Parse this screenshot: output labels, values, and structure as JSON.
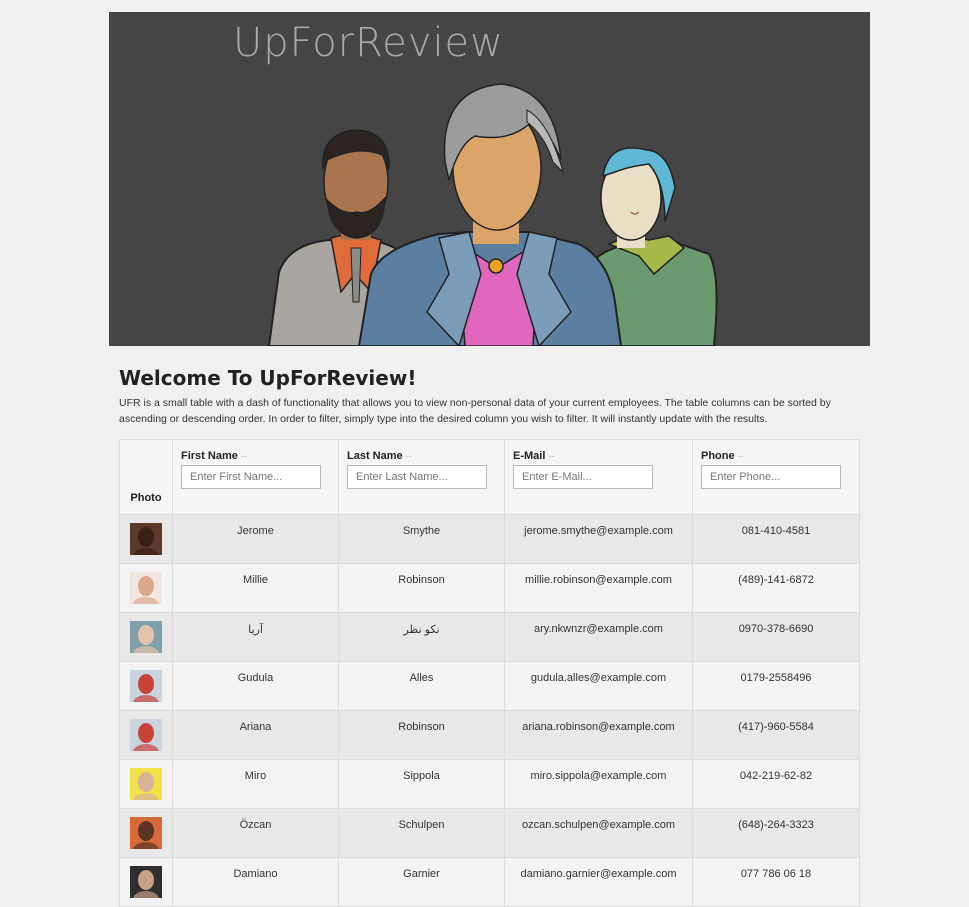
{
  "hero": {
    "title": "UpForReview"
  },
  "intro": {
    "heading": "Welcome To UpForReview!",
    "description": "UFR is a small table with a dash of functionality that allows you to view non-personal data of your current employees. The table columns can be sorted by ascending or descending order. In order to filter, simply type into the desired column you wish to filter. It will instantly update with the results."
  },
  "table": {
    "columns": {
      "photo": "Photo",
      "first": {
        "label": "First Name",
        "placeholder": "Enter First Name..."
      },
      "last": {
        "label": "Last Name",
        "placeholder": "Enter Last Name..."
      },
      "email": {
        "label": "E-Mail",
        "placeholder": "Enter E-Mail..."
      },
      "phone": {
        "label": "Phone",
        "placeholder": "Enter Phone..."
      },
      "sort_indicator": "--"
    },
    "rows": [
      {
        "first": "Jerome",
        "last": "Smythe",
        "email": "jerome.smythe@example.com",
        "phone": "081-410-4581",
        "avatar": {
          "bg": "#5a3a2c",
          "face": "#3a2118"
        }
      },
      {
        "first": "Millie",
        "last": "Robinson",
        "email": "millie.robinson@example.com",
        "phone": "(489)-141-6872",
        "avatar": {
          "bg": "#f3e6e2",
          "face": "#d9a88e"
        }
      },
      {
        "first": "آریا",
        "last": "نکو نظر",
        "email": "ary.nkwnzr@example.com",
        "phone": "0970-378-6690",
        "avatar": {
          "bg": "#7fa0a8",
          "face": "#e4c3ad"
        }
      },
      {
        "first": "Gudula",
        "last": "Alles",
        "email": "gudula.alles@example.com",
        "phone": "0179-2558496",
        "avatar": {
          "bg": "#c9d4df",
          "face": "#c8423a"
        }
      },
      {
        "first": "Ariana",
        "last": "Robinson",
        "email": "ariana.robinson@example.com",
        "phone": "(417)-960-5584",
        "avatar": {
          "bg": "#c9d4df",
          "face": "#c8423a"
        }
      },
      {
        "first": "Miro",
        "last": "Sippola",
        "email": "miro.sippola@example.com",
        "phone": "042-219-62-82",
        "avatar": {
          "bg": "#f1e24a",
          "face": "#d8b39a"
        }
      },
      {
        "first": "Özcan",
        "last": "Schulpen",
        "email": "ozcan.schulpen@example.com",
        "phone": "(648)-264-3323",
        "avatar": {
          "bg": "#d76a3a",
          "face": "#5b3424"
        }
      },
      {
        "first": "Damiano",
        "last": "Garnier",
        "email": "damiano.garnier@example.com",
        "phone": "077 786 06 18",
        "avatar": {
          "bg": "#2e2e2e",
          "face": "#c9a08a"
        }
      }
    ]
  }
}
